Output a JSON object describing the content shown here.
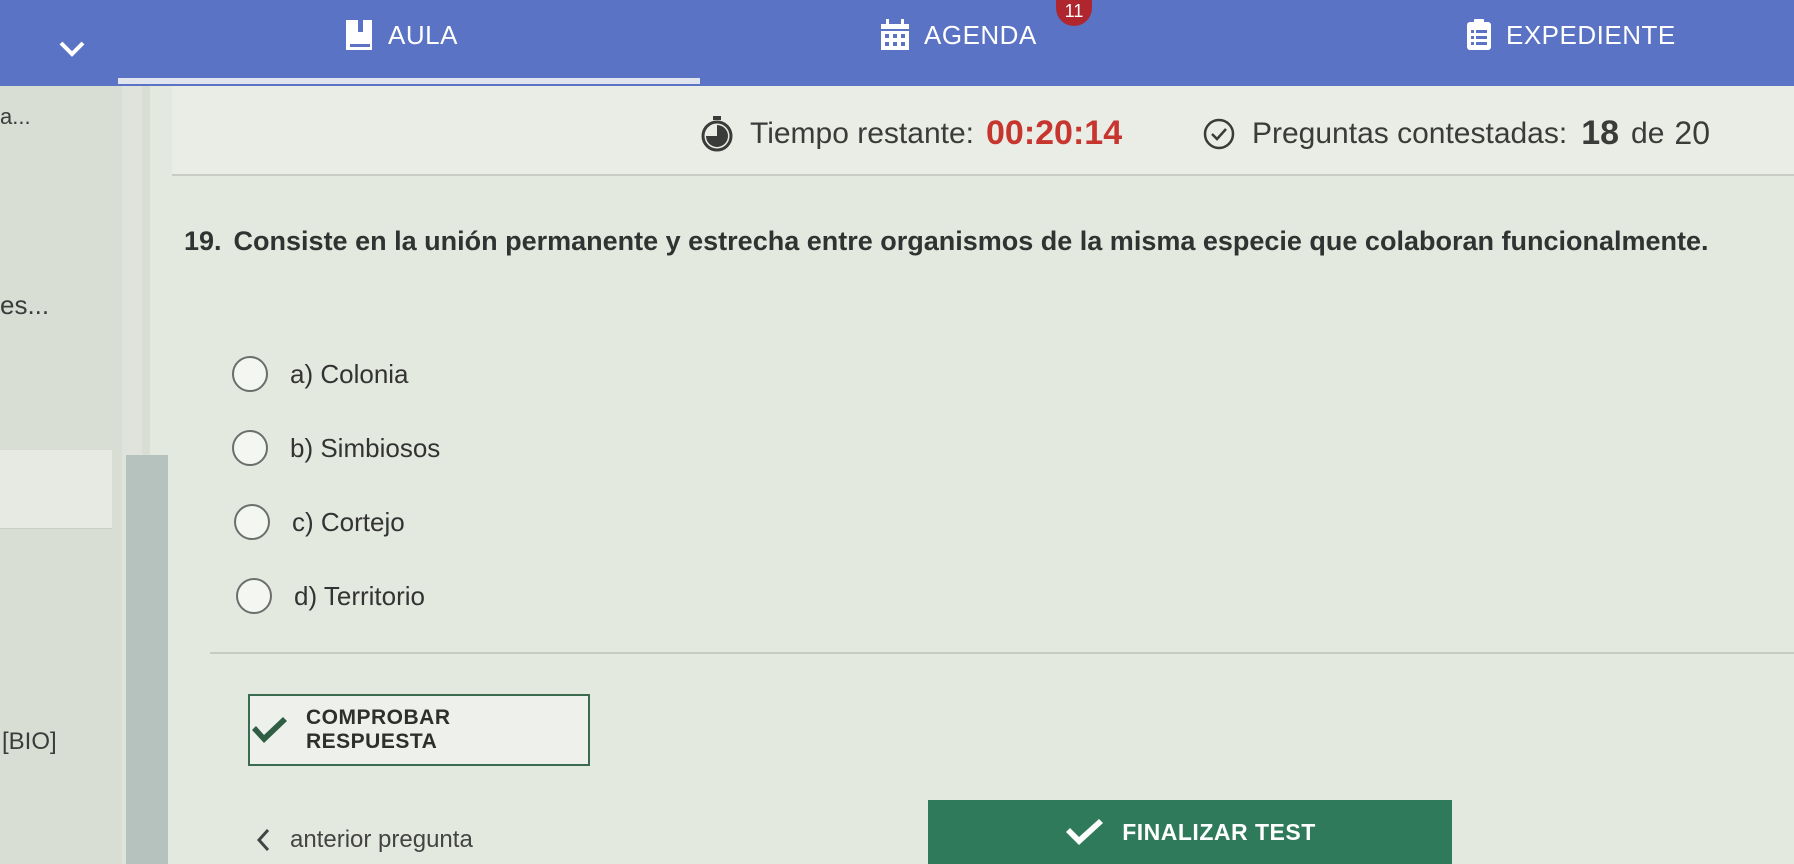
{
  "nav": {
    "aula_label": "AULA",
    "agenda_label": "AGENDA",
    "agenda_badge": "11",
    "expediente_label": "EXPEDIENTE"
  },
  "side": {
    "top_fragment": "a...",
    "middle_fragment": "es...",
    "subject_tag": "[BIO]"
  },
  "status": {
    "time_label": "Tiempo restante:",
    "time_value": "00:20:14",
    "answered_label": "Preguntas contestadas:",
    "answered_count": "18",
    "answered_of": "de",
    "answered_total": "20"
  },
  "question": {
    "number": "19.",
    "text": "Consiste en la unión permanente y estrecha entre organismos de la misma especie que colaboran funcionalmente."
  },
  "options": [
    {
      "label": "a) Colonia"
    },
    {
      "label": "b) Simbiosos"
    },
    {
      "label": "c) Cortejo"
    },
    {
      "label": "d) Territorio"
    }
  ],
  "actions": {
    "check_label": "COMPROBAR RESPUESTA",
    "prev_label": "anterior pregunta",
    "finish_label": "FINALIZAR TEST"
  },
  "colors": {
    "nav_bg": "#5a73c4",
    "timer_value": "#c7352f",
    "badge": "#b0262f",
    "finish_bg": "#2e7a5a",
    "check_mark": "#2f5e44"
  },
  "icons": {
    "aula": "book-icon",
    "agenda": "calendar-icon",
    "expediente": "list-document-icon",
    "timer": "stopwatch-icon",
    "answered": "check-circle-icon",
    "check": "checkmark-icon",
    "prev": "chevron-left-icon",
    "menu": "chevron-down-icon"
  }
}
